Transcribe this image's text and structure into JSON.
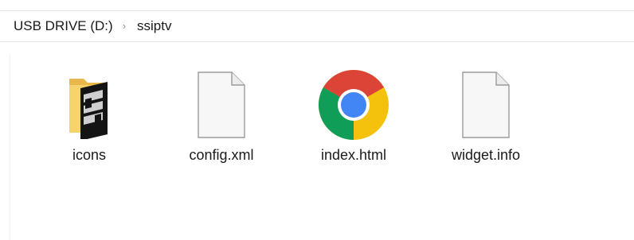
{
  "breadcrumb": {
    "root": "USB DRIVE (D:)",
    "separator": "›",
    "current": "ssiptv"
  },
  "files": [
    {
      "name": "icons",
      "icon": "folder-icon"
    },
    {
      "name": "config.xml",
      "icon": "document-icon"
    },
    {
      "name": "index.html",
      "icon": "chrome-icon"
    },
    {
      "name": "widget.info",
      "icon": "document-icon"
    }
  ],
  "colors": {
    "folder": "#f6d36b",
    "document_fill": "#f7f7f7",
    "document_stroke": "#9a9a9a",
    "chrome_red": "#db4437",
    "chrome_yellow": "#f4c20d",
    "chrome_green": "#0f9d58",
    "chrome_blue": "#4285f4"
  }
}
